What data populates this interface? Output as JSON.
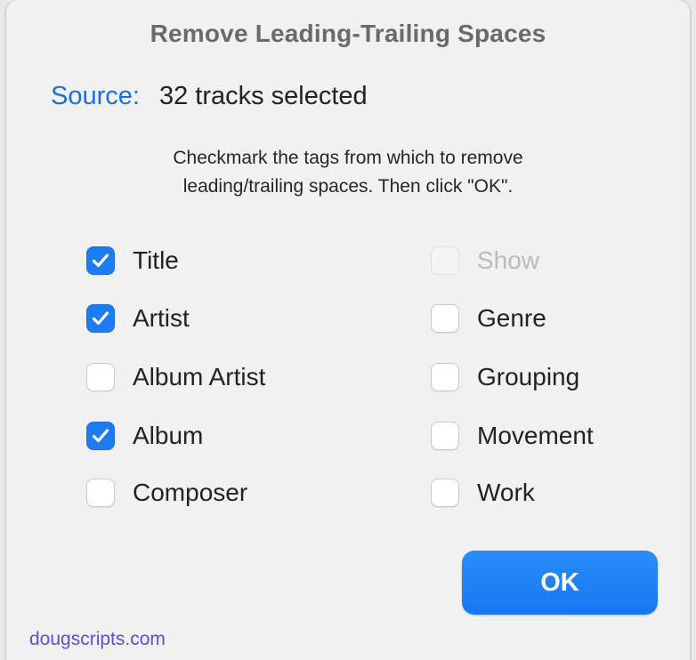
{
  "dialog": {
    "title": "Remove Leading-Trailing Spaces",
    "source_label": "Source:",
    "source_value": "32 tracks selected",
    "instructions_line1": "Checkmark the tags from which to remove",
    "instructions_line2": "leading/trailing spaces. Then click \"OK\".",
    "ok_label": "OK",
    "footer_link": "dougscripts.com"
  },
  "tags_left": [
    {
      "label": "Title",
      "checked": true,
      "enabled": true
    },
    {
      "label": "Artist",
      "checked": true,
      "enabled": true
    },
    {
      "label": "Album Artist",
      "checked": false,
      "enabled": true
    },
    {
      "label": "Album",
      "checked": true,
      "enabled": true
    },
    {
      "label": "Composer",
      "checked": false,
      "enabled": true
    }
  ],
  "tags_right": [
    {
      "label": "Show",
      "checked": false,
      "enabled": false
    },
    {
      "label": "Genre",
      "checked": false,
      "enabled": true
    },
    {
      "label": "Grouping",
      "checked": false,
      "enabled": true
    },
    {
      "label": "Movement",
      "checked": false,
      "enabled": true
    },
    {
      "label": "Work",
      "checked": false,
      "enabled": true
    }
  ],
  "colors": {
    "accent": "#1e7cf2",
    "source_label": "#1a6fe0",
    "link": "#5a52c8",
    "disabled_text": "#bcbcbc"
  }
}
